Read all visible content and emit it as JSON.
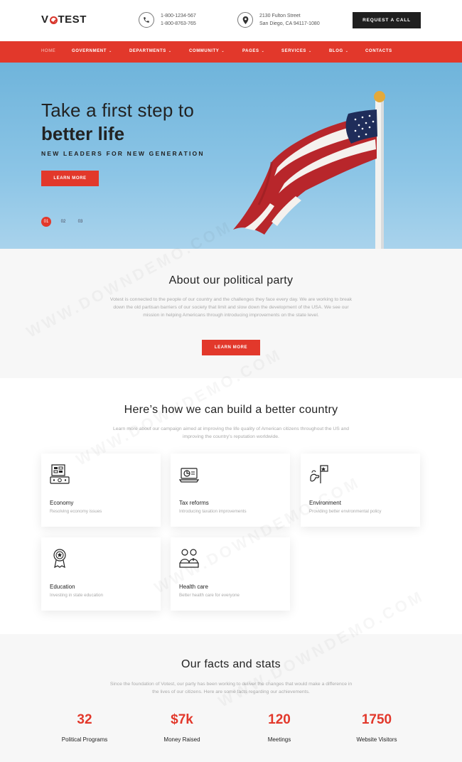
{
  "header": {
    "logo_text_left": "V",
    "logo_text_right": "TEST",
    "phone_lines": [
      "1-800-1234-567",
      "1-800-8763-765"
    ],
    "address_lines": [
      "2130 Fulton Street",
      "San Diego, CA 94117-1080"
    ],
    "request_call_label": "REQUEST A CALL"
  },
  "nav": {
    "items": [
      {
        "label": "HOME",
        "dropdown": false
      },
      {
        "label": "GOVERNMENT",
        "dropdown": true
      },
      {
        "label": "DEPARTMENTS",
        "dropdown": true
      },
      {
        "label": "COMMUNITY",
        "dropdown": true
      },
      {
        "label": "PAGES",
        "dropdown": true
      },
      {
        "label": "SERVICES",
        "dropdown": true
      },
      {
        "label": "BLOG",
        "dropdown": true
      },
      {
        "label": "CONTACTS",
        "dropdown": false
      }
    ]
  },
  "hero": {
    "line1": "Take a first step to",
    "line2": "better life",
    "subtitle": "NEW LEADERS FOR NEW GENERATION",
    "cta_label": "LEARN MORE",
    "slides": [
      "01",
      "02",
      "03"
    ],
    "active_slide": "01"
  },
  "about": {
    "title": "About our political party",
    "text": "Votest is connected to the people of our country and the challenges they face every day. We are working to break down the old partisan barriers of our society that limit and slow down the development of the USA. We see our mission in helping Americans through introducing improvements on the state level.",
    "cta_label": "LEARN MORE"
  },
  "build": {
    "title": "Here’s how we can build a better country",
    "text": "Learn more about our campaign aimed at improving the life quality of American citizens throughout the US and improving the country’s reputation worldwide.",
    "cards": [
      {
        "title": "Economy",
        "desc": "Resolving economy issues",
        "icon": "economy-icon"
      },
      {
        "title": "Tax reforms",
        "desc": "Introducing taxation improvements",
        "icon": "tax-icon"
      },
      {
        "title": "Environment",
        "desc": "Providing better environmental policy",
        "icon": "environment-icon"
      },
      {
        "title": "Education",
        "desc": "Investing in state education",
        "icon": "education-icon"
      },
      {
        "title": "Health care",
        "desc": "Better health care for everyone",
        "icon": "health-icon"
      }
    ]
  },
  "stats": {
    "title": "Our facts and stats",
    "text": "Since the foundation of Votest, our party has been working to deliver the changes that would make a difference in the lives of our citizens. Here are some facts regarding our achievements.",
    "items": [
      {
        "value": "32",
        "label": "Political Programs"
      },
      {
        "value": "$7k",
        "label": "Money Raised"
      },
      {
        "value": "120",
        "label": "Meetings"
      },
      {
        "value": "1750",
        "label": "Website Visitors"
      }
    ]
  },
  "colors": {
    "accent": "#e2382b",
    "dark": "#1f1f1f",
    "sky": "#6fb4db"
  },
  "watermark": "WWW.DOWNDEMO.COM"
}
